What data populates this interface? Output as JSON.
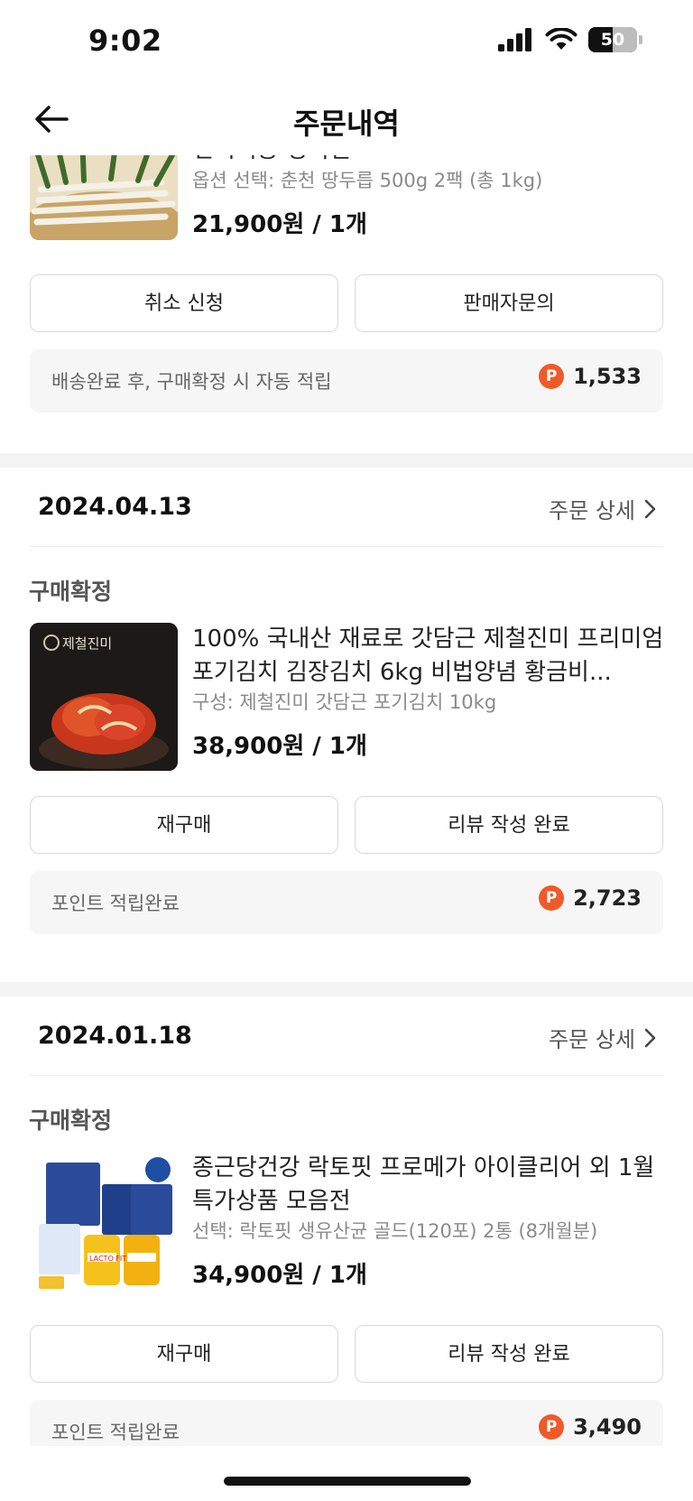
{
  "status_bar": {
    "time": "9:02",
    "battery": "50",
    "battery_level": 0.5
  },
  "nav": {
    "title": "주문내역",
    "back_icon": "back-arrow-icon"
  },
  "orders": [
    {
      "date": "",
      "detail_label": "",
      "status": "",
      "product": {
        "title": "전처리용 명이절",
        "option": "옵션 선택: 춘천 땅두릅 500g 2팩 (총 1kg)",
        "price": "21,900원 / 1개"
      },
      "buttons": [
        "취소 신청",
        "판매자문의"
      ],
      "points": {
        "label": "배송완료 후, 구매확정 시 자동 적립",
        "icon": "P",
        "value": "1,533"
      }
    },
    {
      "date": "2024.04.13",
      "detail_label": "주문 상세",
      "status": "구매확정",
      "product": {
        "title": "100% 국내산 재료로 갓담근 제철진미 프리미엄 포기김치 김장김치 6kg 비법양념 황금비...",
        "option": "구성: 제철진미 갓담근 포기김치 10kg",
        "price": "38,900원 / 1개",
        "image_brand": "제철진미"
      },
      "buttons": [
        "재구매",
        "리뷰 작성 완료"
      ],
      "points": {
        "label": "포인트 적립완료",
        "icon": "P",
        "value": "2,723"
      }
    },
    {
      "date": "2024.01.18",
      "detail_label": "주문 상세",
      "status": "구매확정",
      "product": {
        "title": "종근당건강 락토핏 프로메가 아이클리어 외 1월 특가상품 모음전",
        "option": "선택: 락토핏 생유산균 골드(120포) 2통 (8개월분)",
        "price": "34,900원 / 1개",
        "image_brand": "LACTO FIT"
      },
      "buttons": [
        "재구매",
        "리뷰 작성 완료"
      ],
      "points": {
        "label": "포인트 적립완료",
        "icon": "P",
        "value": "3,490"
      }
    }
  ]
}
